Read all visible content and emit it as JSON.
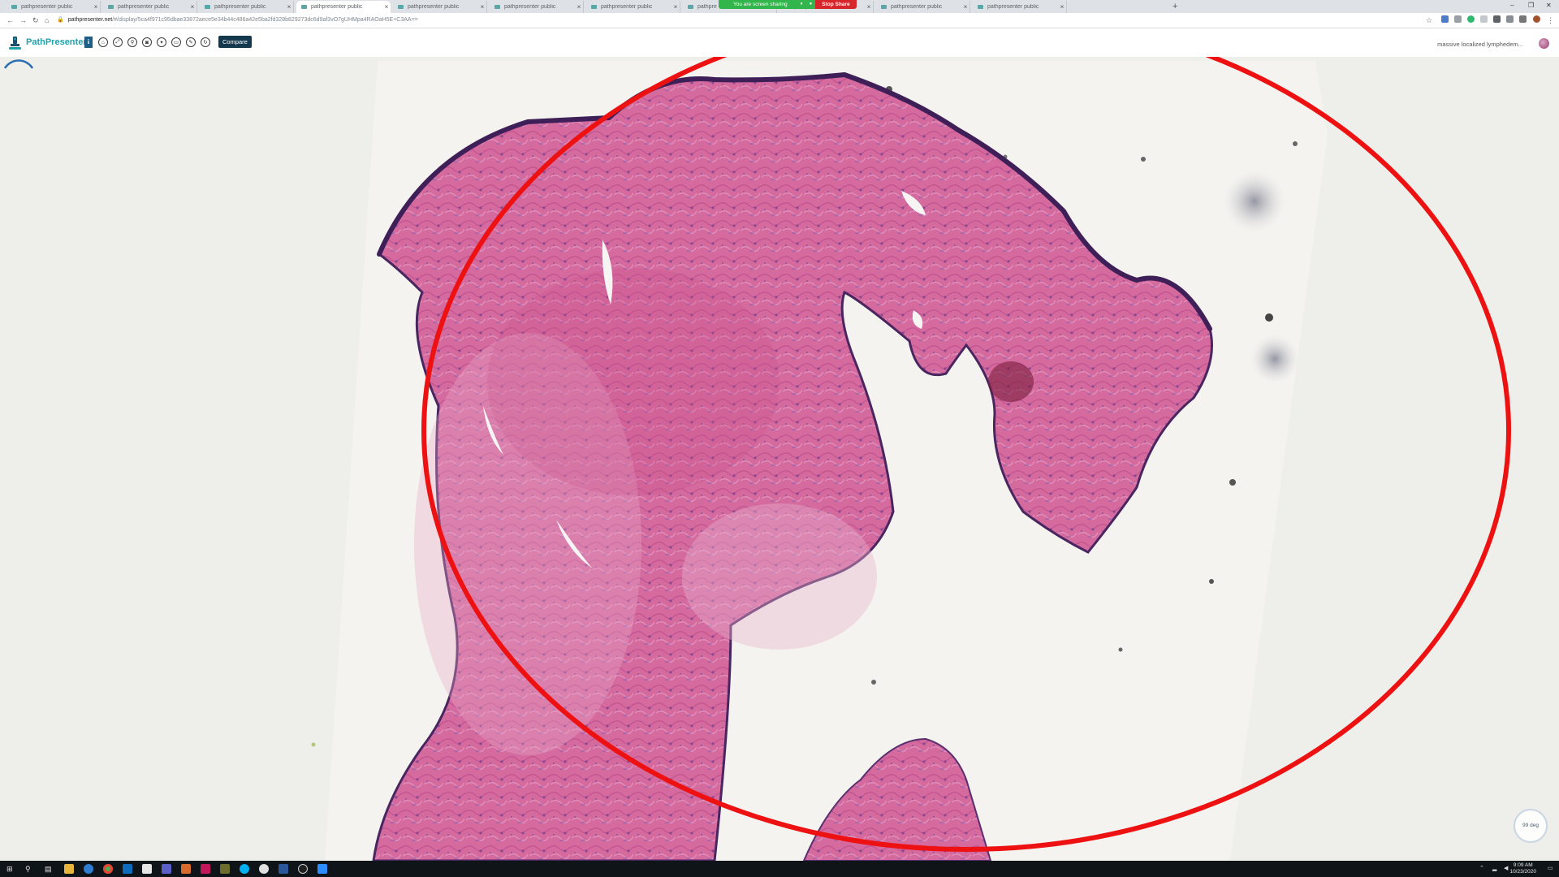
{
  "browser": {
    "tabs": [
      {
        "title": "pathpresenter public",
        "active": false
      },
      {
        "title": "pathpresenter public",
        "active": false
      },
      {
        "title": "pathpresenter public",
        "active": false
      },
      {
        "title": "pathpresenter public",
        "active": true
      },
      {
        "title": "pathpresenter public",
        "active": false
      },
      {
        "title": "pathpresenter public",
        "active": false
      },
      {
        "title": "pathpresenter public",
        "active": false
      },
      {
        "title": "pathpre",
        "active": false
      },
      {
        "title": "pathpresenter public",
        "active": false
      },
      {
        "title": "pathpresenter public",
        "active": false
      },
      {
        "title": "pathpresenter public",
        "active": false
      }
    ],
    "new_tab_symbol": "+",
    "address_domain": "pathpresenter.net",
    "address_path": "/#/display/5ca4f971c95dbae33872aece5e34b44c486a42e5ba2fd328b829273dc6d9af3vO7gUHMpa4RAOaH5E+C3AA==",
    "window_controls": [
      "–",
      "❐",
      "✕"
    ]
  },
  "screen_share": {
    "message": "You are screen sharing",
    "stop_label": "Stop Share"
  },
  "app": {
    "logo_text": "PathPresenter",
    "info_label": "i",
    "tools": [
      {
        "name": "home-tool-button",
        "glyph": "⌂"
      },
      {
        "name": "fullscreen-tool-button",
        "glyph": "⤢"
      },
      {
        "name": "zoom-tool-button",
        "glyph": "⚲"
      },
      {
        "name": "camera-tool-button",
        "glyph": "◙"
      },
      {
        "name": "filter-tool-button",
        "glyph": "▾"
      },
      {
        "name": "screen-tool-button",
        "glyph": "▭"
      },
      {
        "name": "pen-tool-button",
        "glyph": "✎"
      },
      {
        "name": "rotate-tool-button",
        "glyph": "↻"
      }
    ],
    "compare_label": "Compare",
    "slide_title": "massive localized lymphedem..."
  },
  "viewer": {
    "rotation_label": "99 deg",
    "annotation_color": "#ee1111",
    "tissue_color": "#d46a9e"
  },
  "taskbar": {
    "time": "9:09 AM",
    "date": "10/23/2020"
  }
}
